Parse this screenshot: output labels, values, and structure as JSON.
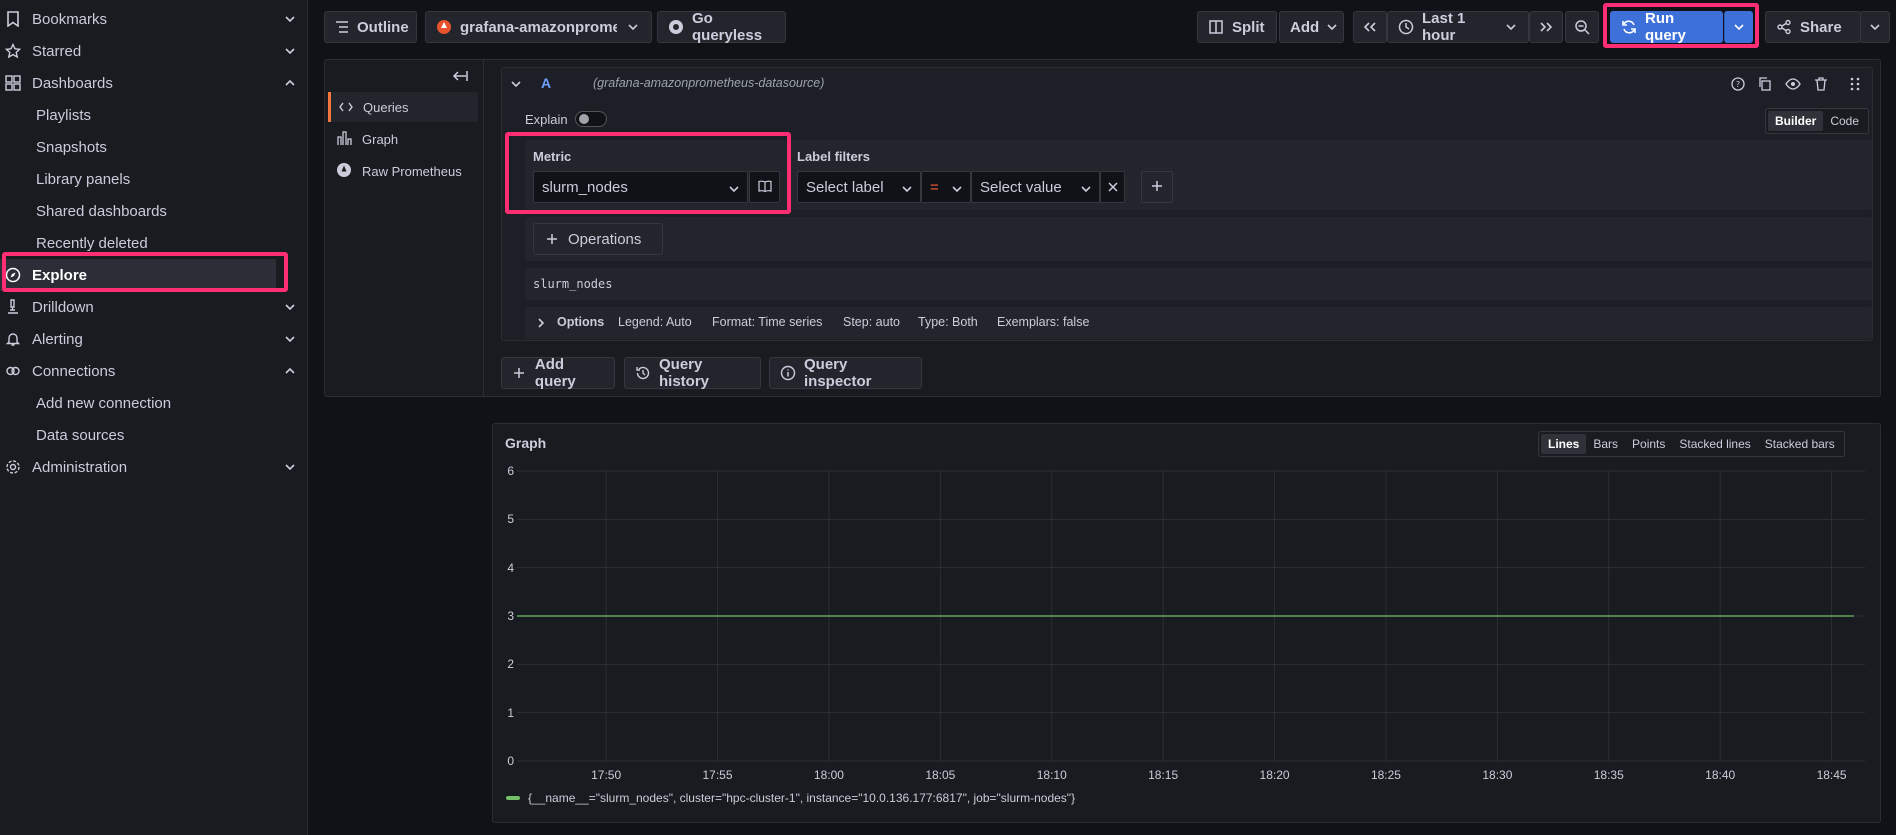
{
  "colors": {
    "accent": "#3d71d9",
    "highlight": "#ff2d73",
    "series": "#73bf69",
    "tab_active": "#f5773b"
  },
  "sidebar": {
    "items": [
      {
        "label": "Bookmarks",
        "icon": "bookmark-icon",
        "chevron": "down"
      },
      {
        "label": "Starred",
        "icon": "star-icon",
        "chevron": "down"
      },
      {
        "label": "Dashboards",
        "icon": "grid-icon",
        "chevron": "up"
      },
      {
        "label": "Playlists"
      },
      {
        "label": "Snapshots"
      },
      {
        "label": "Library panels"
      },
      {
        "label": "Shared dashboards"
      },
      {
        "label": "Recently deleted"
      },
      {
        "label": "Explore",
        "icon": "compass-icon",
        "active": true
      },
      {
        "label": "Drilldown",
        "icon": "microscope-icon",
        "chevron": "down"
      },
      {
        "label": "Alerting",
        "icon": "bell-icon",
        "chevron": "down"
      },
      {
        "label": "Connections",
        "icon": "link-icon",
        "chevron": "up"
      },
      {
        "label": "Add new connection"
      },
      {
        "label": "Data sources"
      },
      {
        "label": "Administration",
        "icon": "gear-icon",
        "chevron": "down"
      }
    ]
  },
  "toolbar": {
    "outline": "Outline",
    "datasource": "grafana-amazonprometheus-datasource",
    "go_queryless": "Go queryless",
    "split": "Split",
    "add": "Add",
    "time_range": "Last 1 hour",
    "run_query": "Run query",
    "share": "Share"
  },
  "editor_tabs": [
    "Queries",
    "Graph",
    "Raw Prometheus"
  ],
  "query": {
    "ref": "A",
    "datasource": "(grafana-amazonprometheus-datasource)",
    "explain": "Explain",
    "mode_builder": "Builder",
    "mode_code": "Code",
    "metric_label": "Metric",
    "metric_value": "slurm_nodes",
    "label_filters": "Label filters",
    "select_label": "Select label",
    "operator": "=",
    "select_value": "Select value",
    "operations": "Operations",
    "preview": "slurm_nodes",
    "options": "Options",
    "options_summary": [
      "Legend: Auto",
      "Format: Time series",
      "Step: auto",
      "Type: Both",
      "Exemplars: false"
    ]
  },
  "actions": {
    "add_query": "Add query",
    "query_history": "Query history",
    "query_inspector": "Query inspector"
  },
  "graph": {
    "title": "Graph",
    "modes": [
      "Lines",
      "Bars",
      "Points",
      "Stacked lines",
      "Stacked bars"
    ],
    "legend": "{__name__=\"slurm_nodes\", cluster=\"hpc-cluster-1\", instance=\"10.0.136.177:6817\", job=\"slurm-nodes\"}"
  },
  "chart_data": {
    "type": "line",
    "title": "Graph",
    "xlabel": "",
    "ylabel": "",
    "ylim": [
      0,
      6
    ],
    "yticks": [
      "0",
      "1",
      "2",
      "3",
      "4",
      "5",
      "6"
    ],
    "xticks": [
      "17:50",
      "17:55",
      "18:00",
      "18:05",
      "18:10",
      "18:15",
      "18:20",
      "18:25",
      "18:30",
      "18:35",
      "18:40",
      "18:45"
    ],
    "grid": true,
    "legend": "bottom-left",
    "series": [
      {
        "name": "{__name__=\"slurm_nodes\", cluster=\"hpc-cluster-1\", instance=\"10.0.136.177:6817\", job=\"slurm-nodes\"}",
        "x": [
          "17:46",
          "18:46"
        ],
        "values": [
          3,
          3
        ]
      }
    ]
  }
}
